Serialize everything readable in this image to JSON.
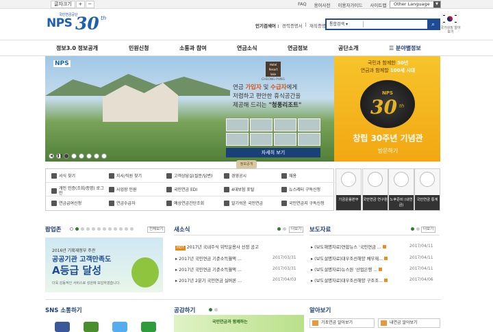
{
  "topbar": {
    "fontsize_label": "글자크기",
    "plus": "+",
    "minus": "−",
    "links": [
      "FAQ",
      "용어사전",
      "이용자가이드",
      "사이트맵"
    ],
    "other_language": "Other Language"
  },
  "header": {
    "logo_small": "국민연금공단",
    "logo_nps": "NPS",
    "logo_30": "30",
    "logo_th": "th",
    "popular_label": "인기검색어 :",
    "popular_keywords": [
      "경력증명서",
      "|",
      "재직증명서"
    ],
    "search_select": "통합검색 ▾",
    "search_placeholder": "",
    "flag_caption": "국가상징 알아보기"
  },
  "nav": {
    "items": [
      "정보3.0 정보공개",
      "민원신청",
      "소통과 참여",
      "연금소식",
      "연금정보",
      "공단소개",
      "분야별정보"
    ]
  },
  "hero": {
    "nps_label": "NPS",
    "hotel_logo": "Hotel Resort lake",
    "hotel_name": "CHEONG PUNG",
    "copy_line1_a": "연금 ",
    "copy_line1_hl1": "가입자",
    "copy_line1_b": " 및 ",
    "copy_line1_hl2": "수급자",
    "copy_line1_c": "에게",
    "copy_line2": "저렴하고 편안한 휴식공간을",
    "copy_line3_a": "제공해 드리는 ",
    "copy_line3_name": "\"청풍리조트\"",
    "more_button": "자세히 보기",
    "ctrl": [
      "◀",
      "❚❚",
      "●",
      "●",
      "●",
      "●",
      "●",
      "●"
    ]
  },
  "banner30": {
    "line1_a": "국민과 함께한 ",
    "line1_hl": "30년",
    "line2_a": "연금과 함께할 ",
    "line2_hl": "100세 시대",
    "nps": "NPS",
    "num": "30",
    "th": "th",
    "title": "창립 30주년 기념관",
    "visit": "방문하기"
  },
  "tag_icon": "정보공개",
  "quick": [
    [
      "서식 찾기",
      "지사/직원 찾기",
      "고객상담실(질문/답변)",
      "경영공시",
      "채용"
    ],
    [
      "개인 인증(조회/증명) 로그인",
      "사업장 민원",
      "국민연금 EDI",
      "4대보험 포털",
      "뉴스레터 구독신청"
    ],
    [
      "연금급여신청",
      "연금수급자",
      "예상연금간단조회",
      "알기쉬운 국민연금",
      "국민연금지 구독신청"
    ]
  ],
  "tiles": [
    "기금운용본부",
    "국민연금 연구원",
    "노후준비 (내연금)",
    "국민연금 통계"
  ],
  "popupzone": {
    "title": "팝업존",
    "page": "1",
    "all_label": "전체보기",
    "t1": "2016년 기획재정부 주관",
    "t2": "공공기관 고객만족도",
    "t3": "A등급 달성",
    "t4": "더욱 감동적인 서비스로 성원에 보답하겠습니다."
  },
  "news": {
    "title": "새소식",
    "more": "더보기",
    "hot": "HOT",
    "items": [
      {
        "text": "2017년 국내주식 위탁운용사 선정 공고",
        "date": ""
      },
      {
        "text": "2017년 국민연금 기준소득월액 ...",
        "date": "2017/03/31"
      },
      {
        "text": "2017년 국민연금 기준소득월액 ...",
        "date": "2017/03/31"
      },
      {
        "text": "2017년 2분기 국민연금 실버론 ...",
        "date": "2017/04/03"
      }
    ]
  },
  "press": {
    "title": "보도자료",
    "more": "더보기",
    "items": [
      {
        "text": "(보도해명자료)연합뉴스 '국민연금 ...",
        "date": "2017/04/11"
      },
      {
        "text": "(보도설명자료)대우조선해양 채무재...",
        "date": "2017/04/11"
      },
      {
        "text": "(보도설명자료)뉴스원 '산업은행 ...",
        "date": "2017/04/11"
      },
      {
        "text": "(보도설명자료)대우조선해양 구조조...",
        "date": "2017/04/06"
      }
    ]
  },
  "bottom": {
    "sns_title": "SNS 소통하기",
    "gong_title": "공감하기",
    "gong_text": "국민연금과 함께하는",
    "know_title": "알아보기",
    "know_btn1": "기초연금 알아보기",
    "know_btn2": "내연금 알아보기"
  },
  "colors": {
    "brand_blue": "#1e4c94",
    "banner_yellow": "#f2a712",
    "accent_orange": "#d9521a"
  }
}
